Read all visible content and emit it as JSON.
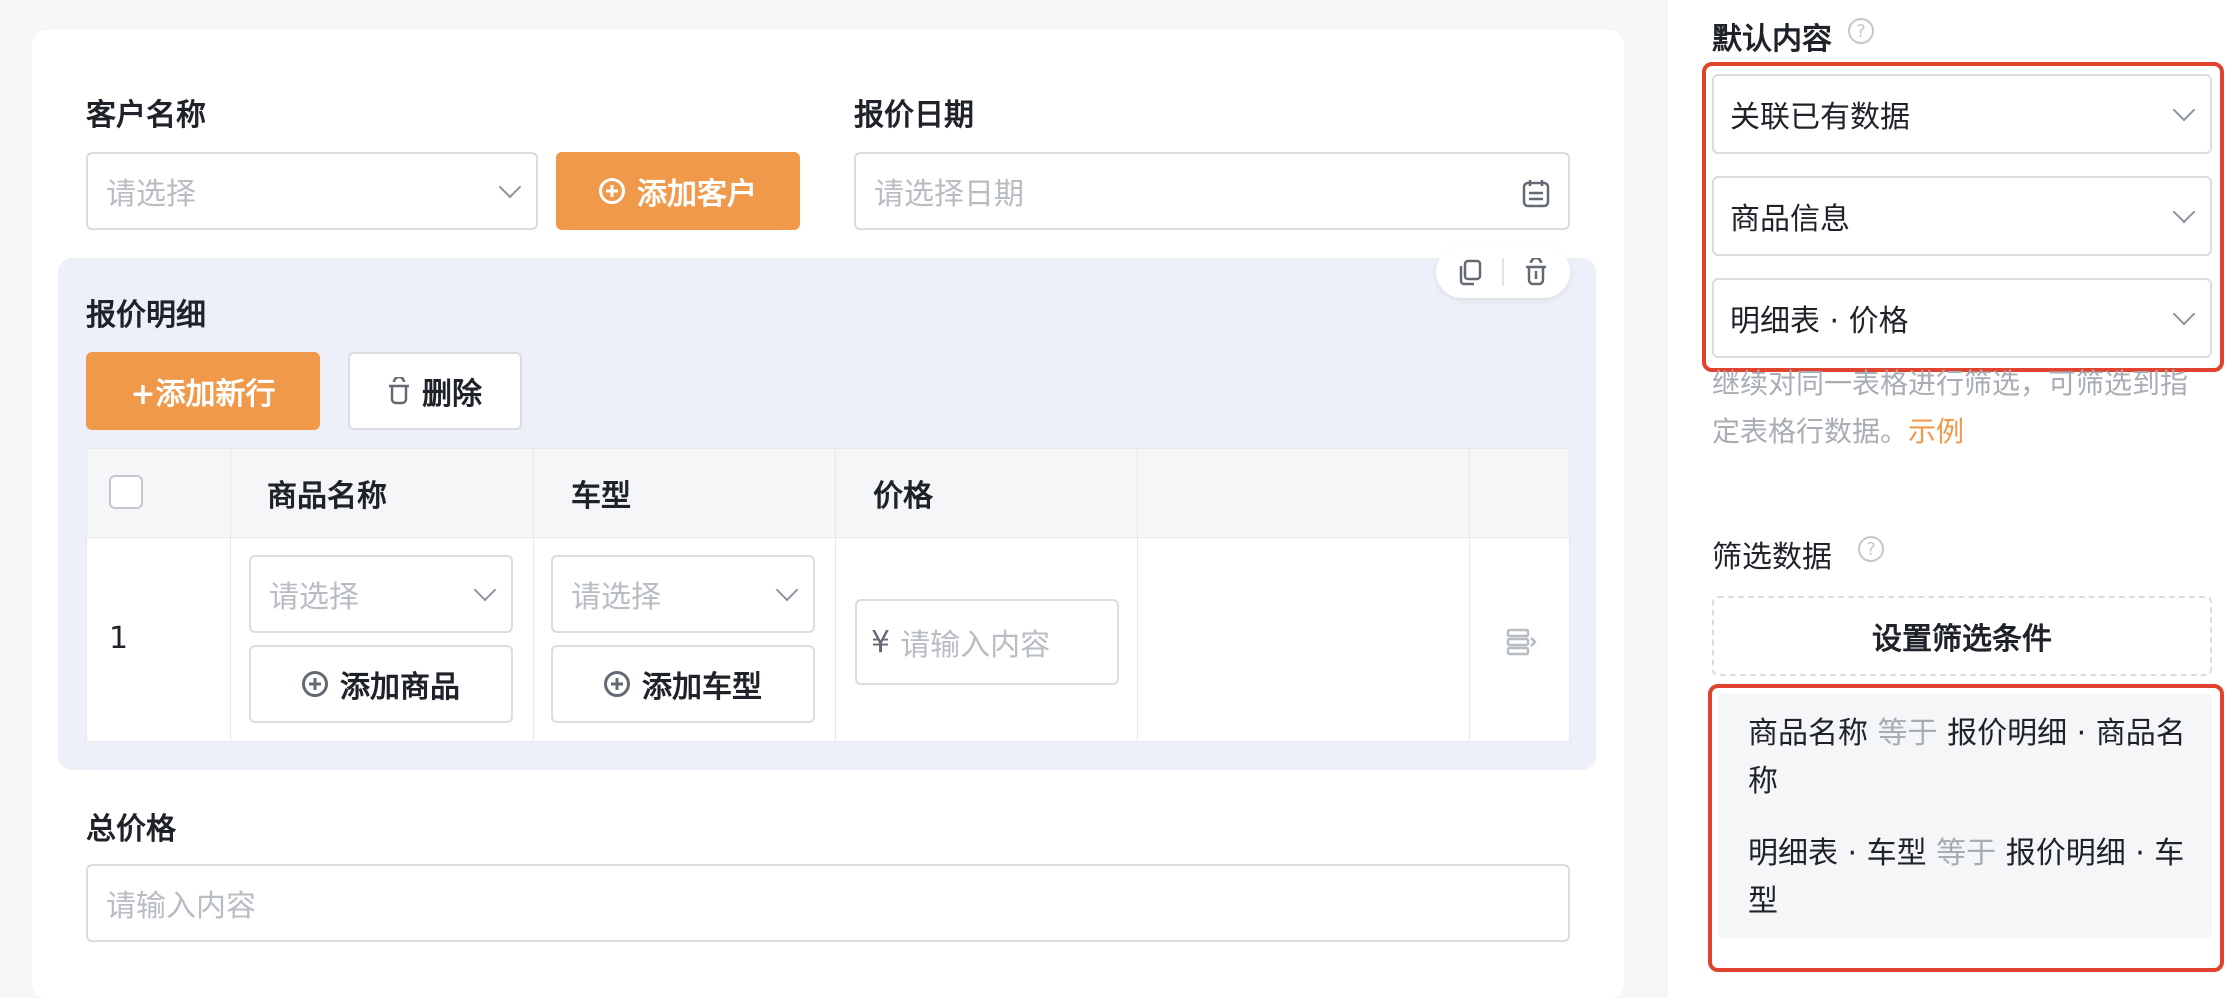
{
  "form": {
    "customer_label": "客户名称",
    "customer_placeholder": "请选择",
    "add_customer_label": "添加客户",
    "quote_date_label": "报价日期",
    "quote_date_placeholder": "请选择日期",
    "detail_title": "报价明细",
    "add_row_label": "+添加新行",
    "delete_label": "删除",
    "table": {
      "columns": [
        "商品名称",
        "车型",
        "价格"
      ],
      "rows": [
        {
          "index": "1",
          "product_placeholder": "请选择",
          "add_product_label": "添加商品",
          "model_placeholder": "请选择",
          "add_model_label": "添加车型",
          "currency": "¥",
          "price_placeholder": "请输入内容"
        }
      ]
    },
    "total_label": "总价格",
    "total_placeholder": "请输入内容"
  },
  "panel": {
    "default_content_label": "默认内容",
    "help_glyph": "?",
    "selects": [
      "关联已有数据",
      "商品信息",
      "明细表 · 价格"
    ],
    "hint_text": "继续对同一表格进行筛选，可筛选到指定表格行数据。",
    "hint_link": "示例",
    "filter_label": "筛选数据",
    "set_filter_label": "设置筛选条件",
    "conditions": [
      {
        "field": "商品名称",
        "op": "等于",
        "value": "报价明细 · 商品名称"
      },
      {
        "field": "明细表 · 车型",
        "op": "等于",
        "value": "报价明细 · 车型"
      }
    ]
  },
  "colors": {
    "accent": "#f0994a",
    "highlight_border": "#e1432f",
    "detail_bg": "#edf0f8"
  }
}
